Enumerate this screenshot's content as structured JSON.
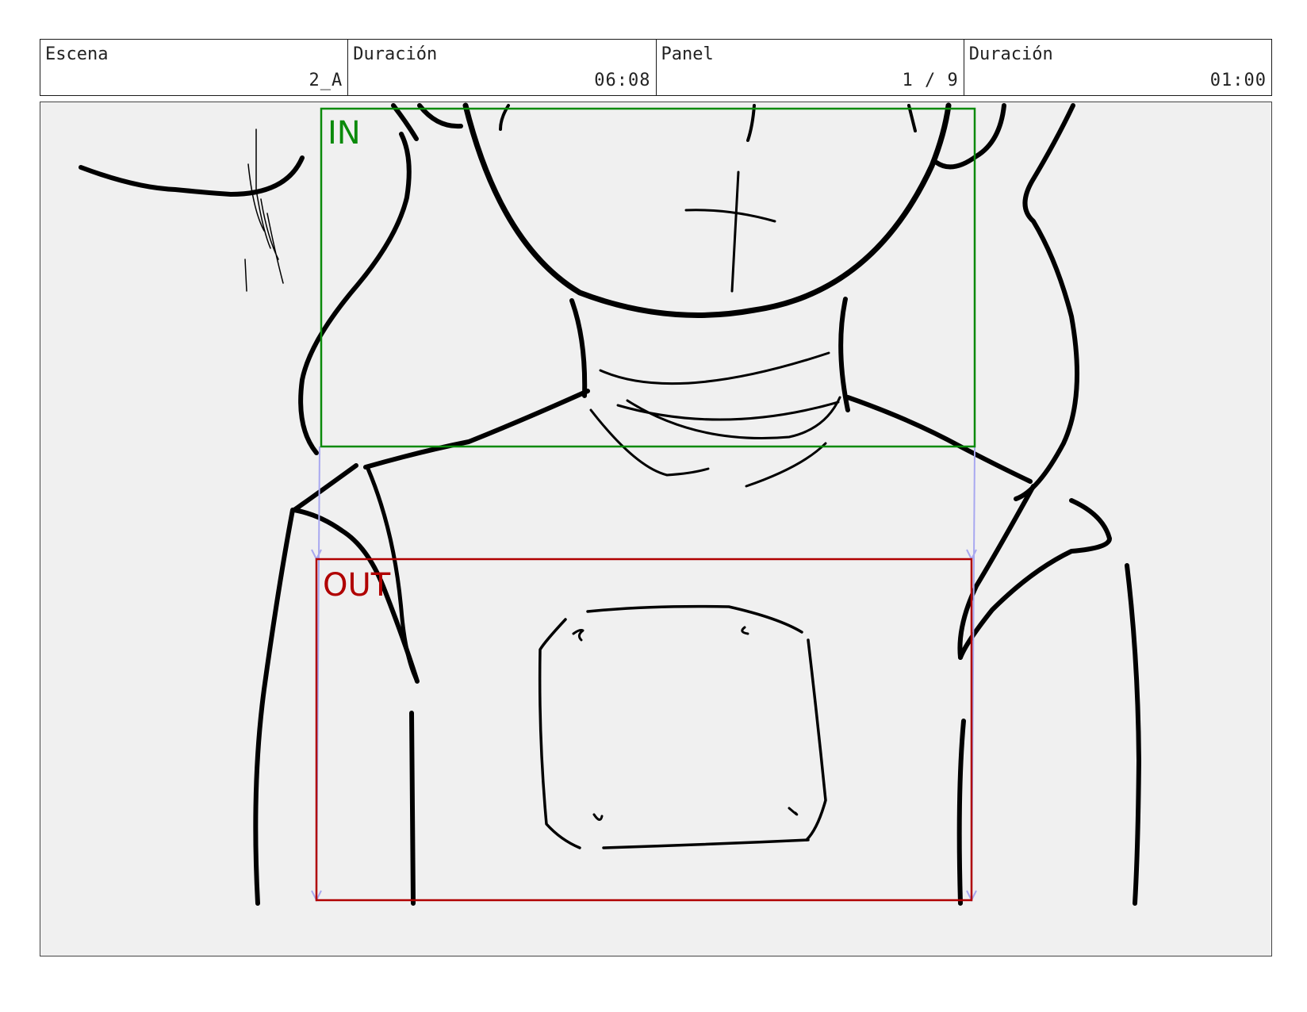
{
  "header": {
    "scene_label": "Escena",
    "scene_value": "2_A",
    "duration_label": "Duración",
    "duration_value": "06:08",
    "panel_label": "Panel",
    "panel_value": "1 / 9",
    "panel_duration_label": "Duración",
    "panel_duration_value": "01:00"
  },
  "frame": {
    "in_label": "IN",
    "out_label": "OUT",
    "colors": {
      "in": "#0a8a0a",
      "out": "#b00000",
      "motion": "#a8a8f0",
      "ink": "#000000",
      "background": "#f0f0f0"
    }
  }
}
